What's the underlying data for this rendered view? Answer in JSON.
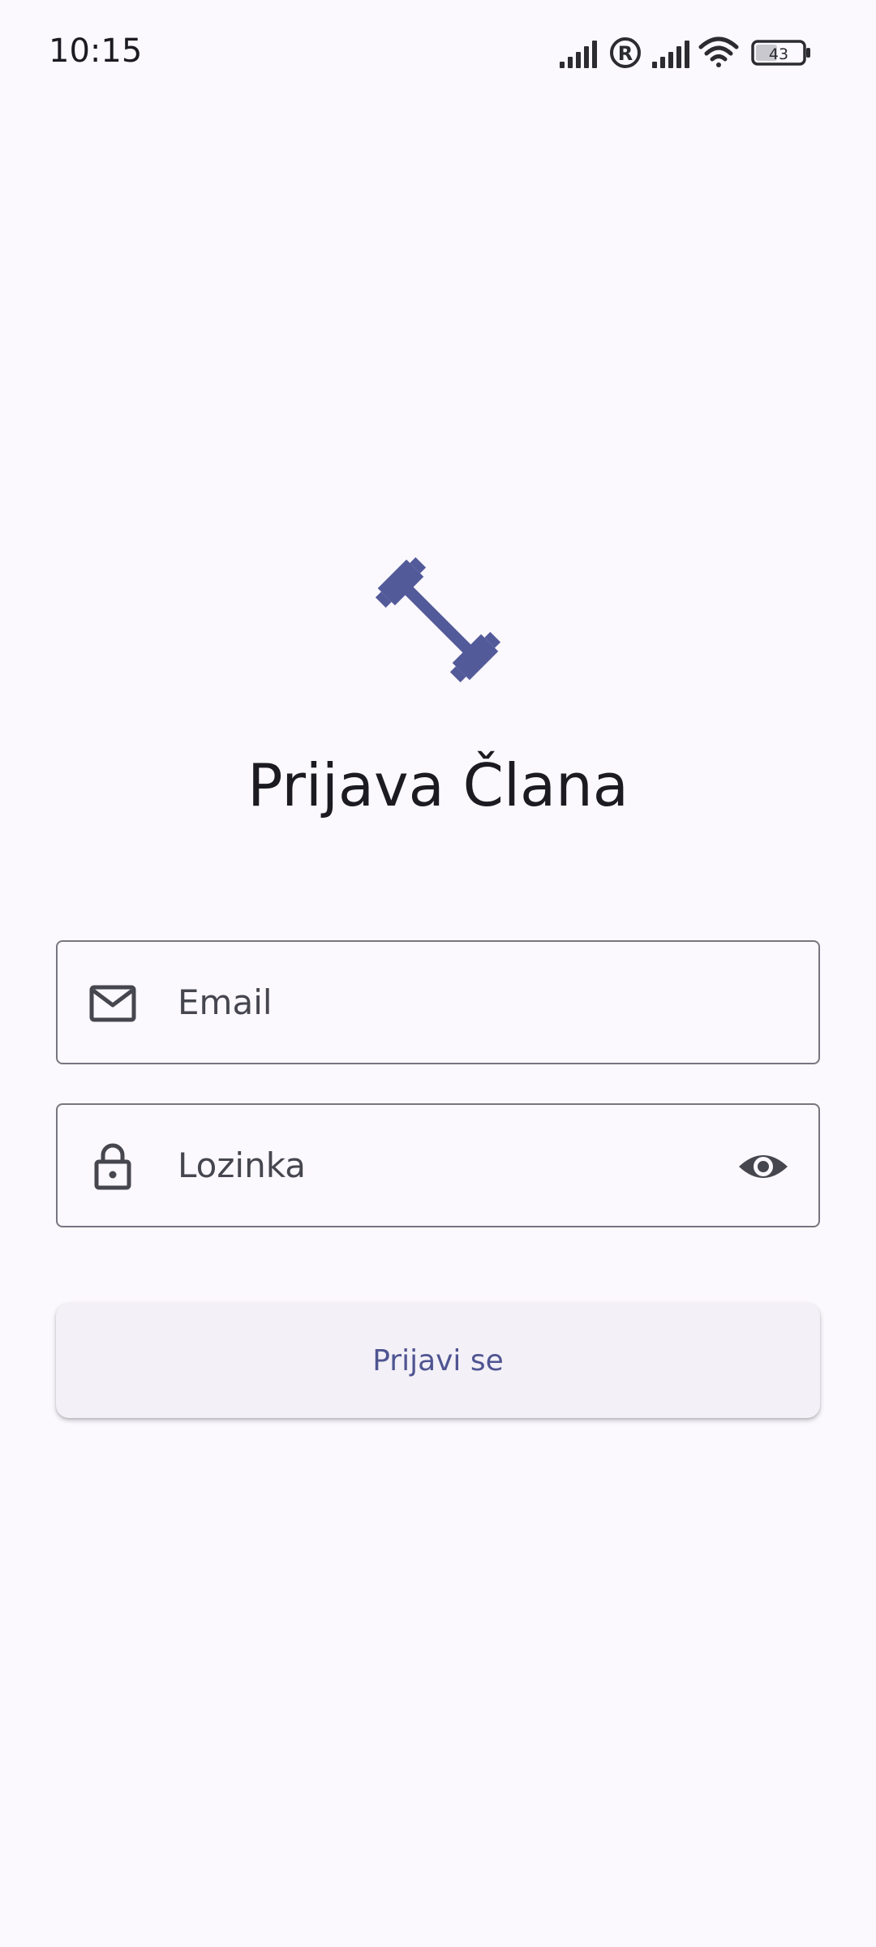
{
  "status_bar": {
    "time": "10:15",
    "battery_level": "43",
    "icons": [
      "signal-icon",
      "roaming-icon",
      "signal-icon",
      "wifi-icon",
      "battery-icon"
    ]
  },
  "login": {
    "logo_icon": "dumbbell-icon",
    "title": "Prijava Člana",
    "email_placeholder": "Email",
    "email_icon": "mail-icon",
    "password_placeholder": "Lozinka",
    "password_icon": "lock-icon",
    "visibility_icon": "eye-icon",
    "submit_label": "Prijavi se"
  },
  "colors": {
    "background": "#fbf8fe",
    "brand": "#535a99",
    "button_bg": "#f3f0f7",
    "button_text": "#4f5591",
    "outline": "#77767f"
  }
}
